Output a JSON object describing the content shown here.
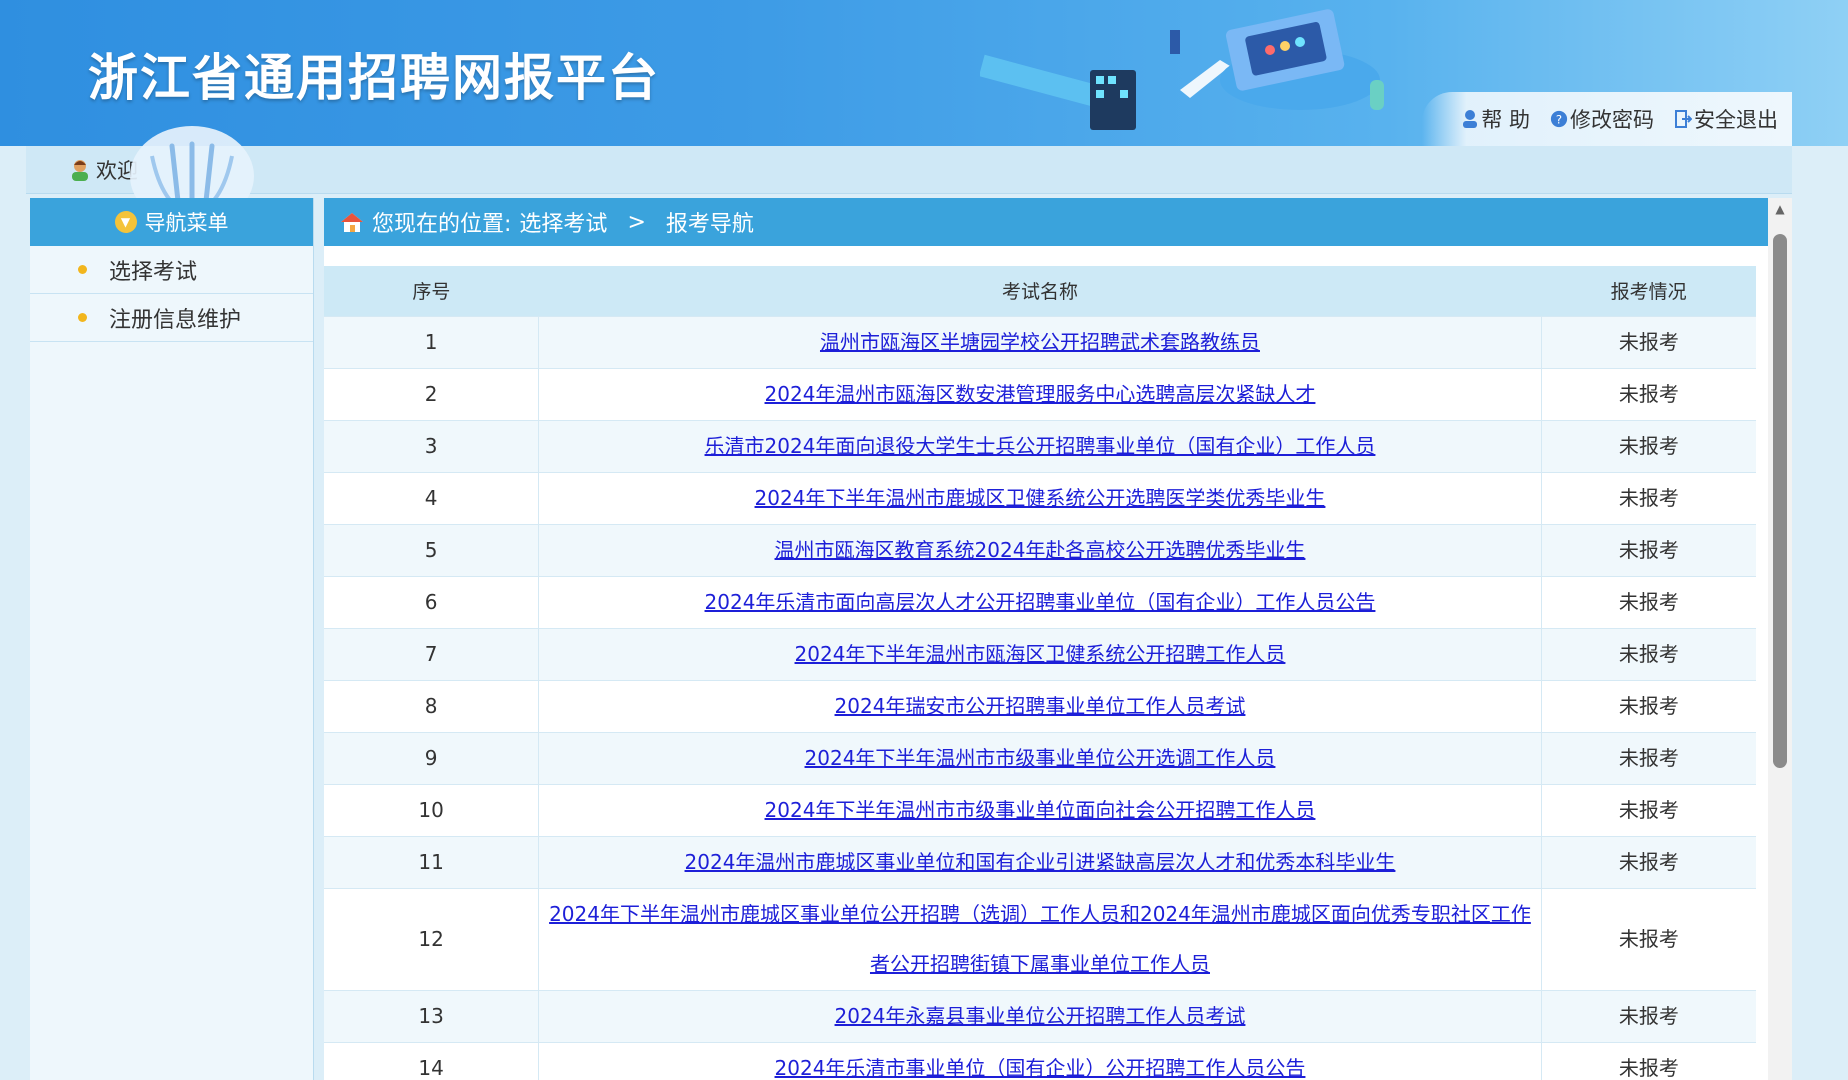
{
  "header": {
    "site_title": "浙江省通用招聘网报平台",
    "links": [
      {
        "label": "帮 助",
        "icon": "user-help-icon"
      },
      {
        "label": "修改密码",
        "icon": "question-icon"
      },
      {
        "label": "安全退出",
        "icon": "exit-icon"
      }
    ]
  },
  "welcome": {
    "text": "欢迎"
  },
  "sidebar": {
    "title": "导航菜单",
    "items": [
      {
        "label": "选择考试"
      },
      {
        "label": "注册信息维护"
      }
    ]
  },
  "breadcrumb": {
    "prefix": "您现在的位置:",
    "items": [
      "选择考试",
      "报考导航"
    ],
    "separator": ">"
  },
  "table": {
    "headers": [
      "序号",
      "考试名称",
      "报考情况"
    ],
    "rows": [
      {
        "no": "1",
        "name": "温州市瓯海区半塘园学校公开招聘武术套路教练员",
        "status": "未报考"
      },
      {
        "no": "2",
        "name": "2024年温州市瓯海区数安港管理服务中心选聘高层次紧缺人才",
        "status": "未报考"
      },
      {
        "no": "3",
        "name": "乐清市2024年面向退役大学生士兵公开招聘事业单位（国有企业）工作人员",
        "status": "未报考"
      },
      {
        "no": "4",
        "name": "2024年下半年温州市鹿城区卫健系统公开选聘医学类优秀毕业生",
        "status": "未报考"
      },
      {
        "no": "5",
        "name": "温州市瓯海区教育系统2024年赴各高校公开选聘优秀毕业生",
        "status": "未报考"
      },
      {
        "no": "6",
        "name": "2024年乐清市面向高层次人才公开招聘事业单位（国有企业）工作人员公告",
        "status": "未报考"
      },
      {
        "no": "7",
        "name": "2024年下半年温州市瓯海区卫健系统公开招聘工作人员",
        "status": "未报考"
      },
      {
        "no": "8",
        "name": "2024年瑞安市公开招聘事业单位工作人员考试",
        "status": "未报考"
      },
      {
        "no": "9",
        "name": "2024年下半年温州市市级事业单位公开选调工作人员",
        "status": "未报考"
      },
      {
        "no": "10",
        "name": "2024年下半年温州市市级事业单位面向社会公开招聘工作人员",
        "status": "未报考"
      },
      {
        "no": "11",
        "name": "2024年温州市鹿城区事业单位和国有企业引进紧缺高层次人才和优秀本科毕业生",
        "status": "未报考"
      },
      {
        "no": "12",
        "name": "2024年下半年温州市鹿城区事业单位公开招聘（选调）工作人员和2024年温州市鹿城区面向优秀专职社区工作者公开招聘街镇下属事业单位工作人员",
        "status": "未报考"
      },
      {
        "no": "13",
        "name": "2024年永嘉县事业单位公开招聘工作人员考试",
        "status": "未报考"
      },
      {
        "no": "14",
        "name": "2024年乐清市事业单位（国有企业）公开招聘工作人员公告",
        "status": "未报考"
      }
    ]
  },
  "colors": {
    "header_blue": "#2f8fe0",
    "bar_blue": "#3aa3dc",
    "link_blue": "#1d1fd8",
    "table_header": "#cde9f6"
  }
}
